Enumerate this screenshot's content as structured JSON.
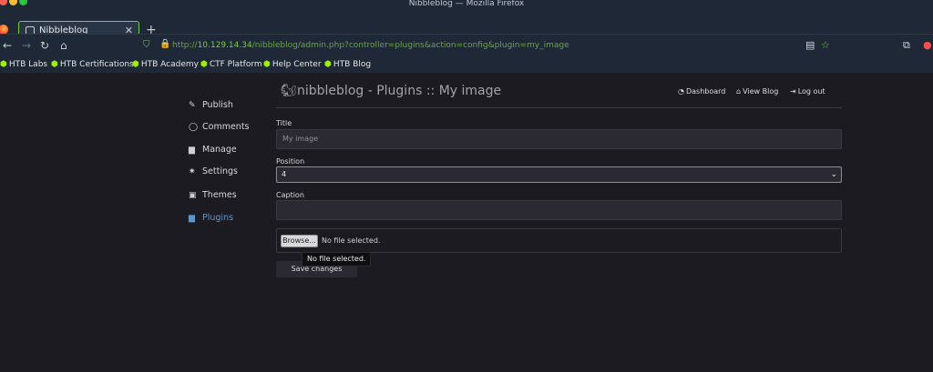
{
  "window": {
    "title": "Nibbleblog — Mozilla Firefox"
  },
  "tab": {
    "title": "Nibbleblog",
    "close": "✕",
    "new": "+"
  },
  "url": {
    "lead": "http://",
    "host": "10.129.14.34",
    "path": "/nibbleblog/admin.php?controller=plugins&action=config&plugin=my_image"
  },
  "bookmarks": [
    "HTB Labs",
    "HTB Certifications",
    "HTB Academy",
    "CTF Platform",
    "Help Center",
    "HTB Blog"
  ],
  "sidebar": {
    "items": [
      {
        "label": "Publish",
        "icon": "pencil-icon"
      },
      {
        "label": "Comments",
        "icon": "comment-icon"
      },
      {
        "label": "Manage",
        "icon": "folder-icon"
      },
      {
        "label": "Settings",
        "icon": "gear-icon"
      },
      {
        "label": "Themes",
        "icon": "image-icon"
      },
      {
        "label": "Plugins",
        "icon": "folder-icon",
        "active": true
      }
    ]
  },
  "header": {
    "title": "nibbleblog - Plugins :: My image",
    "links": [
      "Dashboard",
      "View Blog",
      "Log out"
    ]
  },
  "form": {
    "title_label": "Title",
    "title_value": "My image",
    "position_label": "Position",
    "position_value": "4",
    "caption_label": "Caption",
    "caption_value": "",
    "browse_label": "Browse...",
    "file_status": "No file selected.",
    "tooltip": "No file selected.",
    "save_label": "Save changes"
  },
  "colors": {
    "accent": "#4c9de0",
    "url_green": "#7acb3f",
    "htb_green": "#9fef00",
    "background": "#1c1b22"
  }
}
